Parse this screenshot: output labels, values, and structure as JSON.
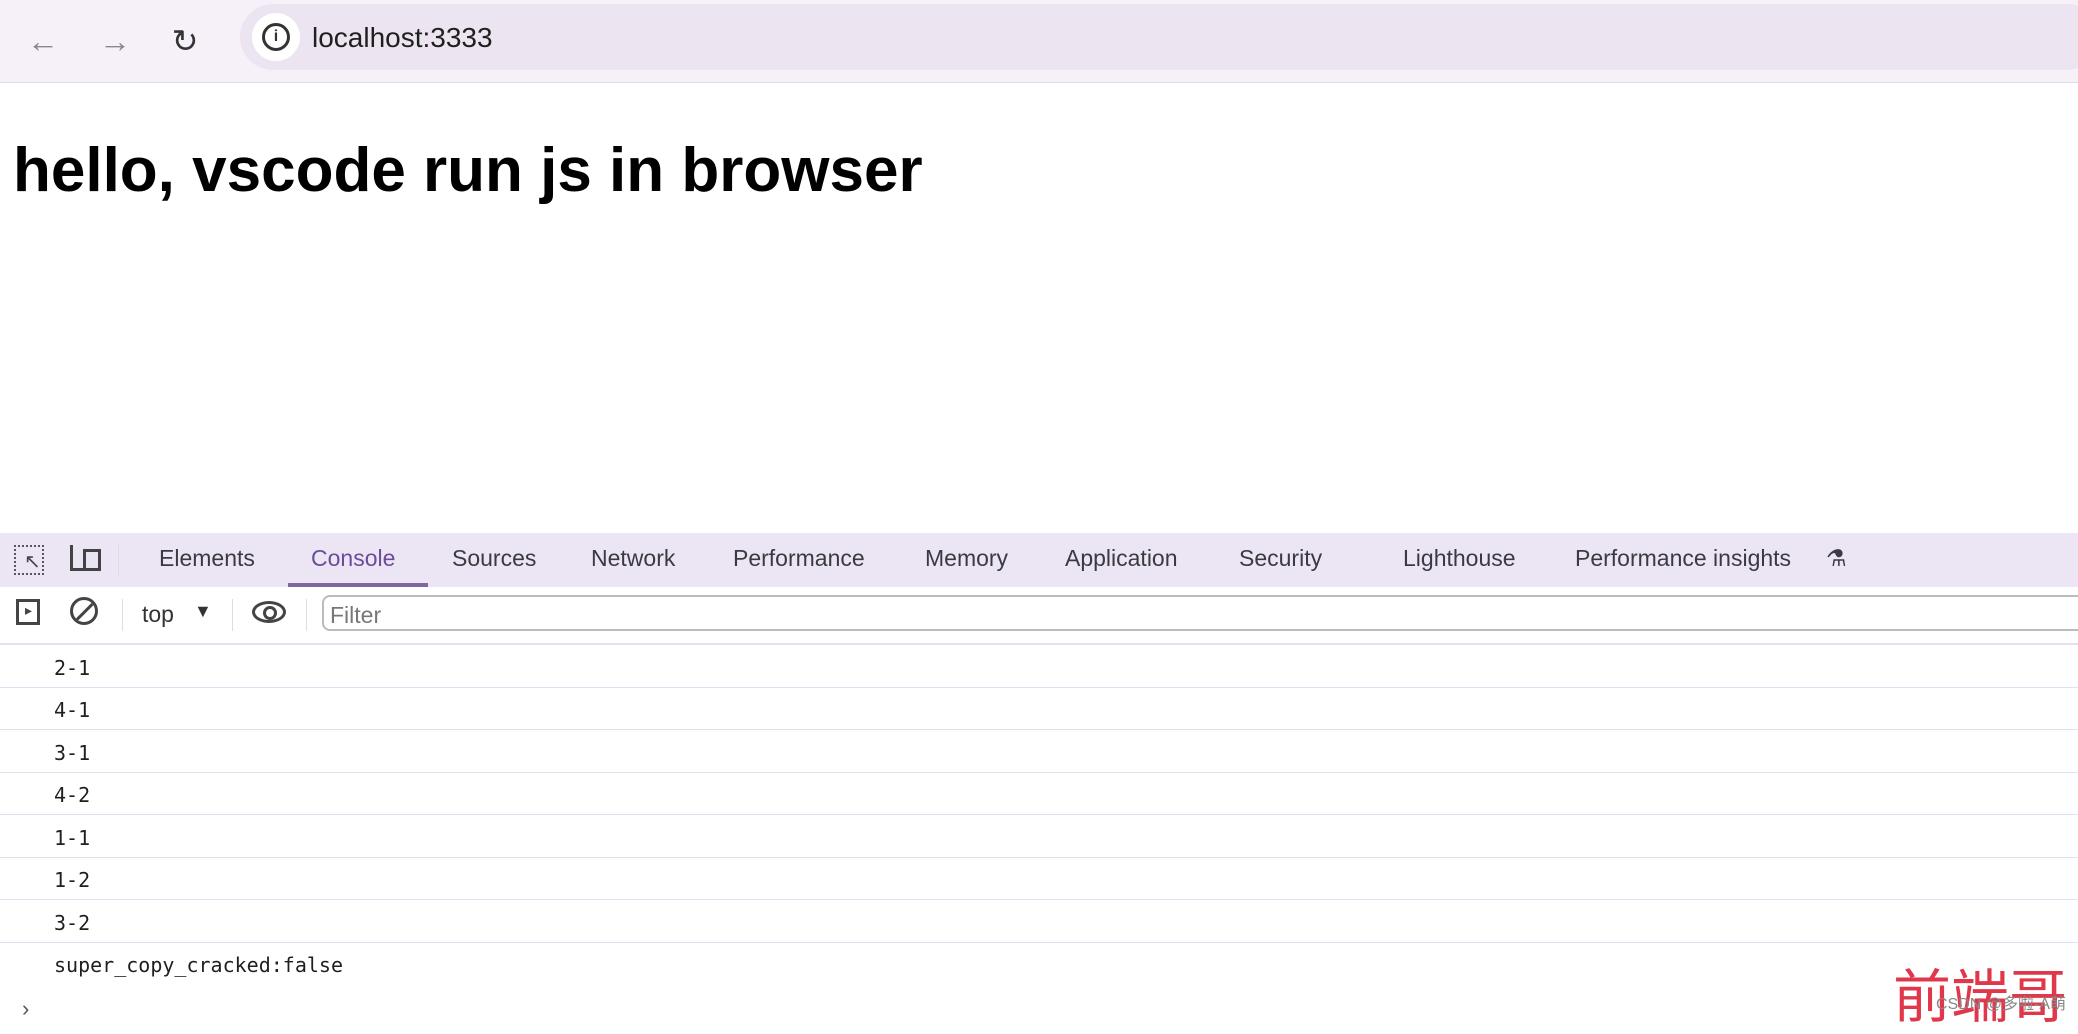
{
  "browser": {
    "url": "localhost:3333"
  },
  "page": {
    "heading": "hello, vscode run js in browser"
  },
  "devtools": {
    "tabs": [
      "Elements",
      "Console",
      "Sources",
      "Network",
      "Performance",
      "Memory",
      "Application",
      "Security",
      "Lighthouse",
      "Performance insights"
    ],
    "active_tab": "Console",
    "context": "top",
    "filter_placeholder": "Filter",
    "accent": "#6b4c9a"
  },
  "console": {
    "lines": [
      "2-1",
      "4-1",
      "3-1",
      "4-2",
      "1-1",
      "1-2",
      "3-2",
      "super_copy_cracked:false"
    ],
    "prompt": "›"
  },
  "watermark": {
    "main": "前端哥",
    "credit": "CSDN @多啦-A萌"
  }
}
